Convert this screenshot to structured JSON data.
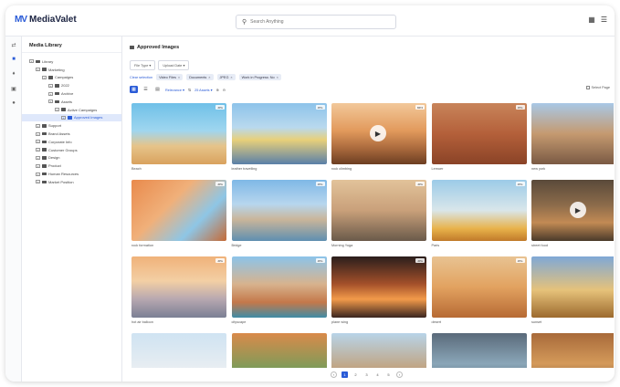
{
  "app": {
    "name": "MediaValet",
    "logo_mark": "MV"
  },
  "search": {
    "placeholder": "Search Anything"
  },
  "sidebar": {
    "title": "Media Library",
    "tree": [
      {
        "label": "Library",
        "depth": 0
      },
      {
        "label": "Marketing",
        "depth": 1
      },
      {
        "label": "Campaigns",
        "depth": 2
      },
      {
        "label": "2022",
        "depth": 3
      },
      {
        "label": "Archive",
        "depth": 3
      },
      {
        "label": "Assets",
        "depth": 3
      },
      {
        "label": "Active Campaigns",
        "depth": 4
      },
      {
        "label": "Approved Images",
        "depth": 5,
        "selected": true
      },
      {
        "label": "Support",
        "depth": 1
      },
      {
        "label": "Brand Assets",
        "depth": 1
      },
      {
        "label": "Corporate Info",
        "depth": 1
      },
      {
        "label": "Customer Groups",
        "depth": 1
      },
      {
        "label": "Design",
        "depth": 1
      },
      {
        "label": "Product",
        "depth": 1
      },
      {
        "label": "Human Resources",
        "depth": 1
      },
      {
        "label": "Market Position",
        "depth": 1
      }
    ]
  },
  "main": {
    "breadcrumb": "Approved Images",
    "filters": [
      {
        "label": "File Type"
      },
      {
        "label": "Upload Date"
      }
    ],
    "clear_label": "Clear selection",
    "chips": [
      {
        "label": "Video Files"
      },
      {
        "label": "Documents"
      },
      {
        "label": "JPEG"
      },
      {
        "label": "Work in Progress: No"
      }
    ],
    "sort_label": "Relevance",
    "per_page": "25 Assets",
    "select_page": "Select Page"
  },
  "colors": {
    "accent": "#2a5bd7"
  },
  "assets": [
    {
      "caption": "Beach",
      "badge": "JPG",
      "bg": "linear-gradient(#6fc0e8 0%,#9fd6ef 45%,#e6c48a 70%,#d9a25e 100%)"
    },
    {
      "caption": "leather travelling",
      "badge": "JPG",
      "bg": "linear-gradient(#8dc3ea 0%,#b9d9ee 40%,#e8d07a 60%,#5a7fa8 100%)"
    },
    {
      "caption": "rock climbing",
      "badge": "MP4",
      "bg": "linear-gradient(#f2c89a 0%,#e29a5c 45%,#a8683c 75%,#6c3e22 100%)",
      "video": true
    },
    {
      "caption": "Lemuer",
      "badge": "JPG",
      "bg": "linear-gradient(#c8845a 0%,#b4603a 50%,#8a4327 100%)"
    },
    {
      "caption": "new york",
      "badge": "JPG",
      "bg": "linear-gradient(#a8c8e6 0%,#c59a70 50%,#7a5a44 100%)"
    },
    {
      "caption": "rock formation",
      "badge": "JPG",
      "bg": "linear-gradient(135deg,#e98a4c 0%,#f0b07a 40%,#8ec6e6 70%,#c56a36 100%)"
    },
    {
      "caption": "Bridge",
      "badge": "JPG",
      "bg": "linear-gradient(#7fb8e6 0%,#b7d6ee 40%,#c9b59a 65%,#5f8fb0 100%)"
    },
    {
      "caption": "Morning Yoga",
      "badge": "JPG",
      "bg": "linear-gradient(#e2c39a 0%,#c9a07a 50%,#6a5a4a 100%)"
    },
    {
      "caption": "Paris",
      "badge": "JPG",
      "bg": "linear-gradient(#9ccbe8 0%,#d9e6ea 50%,#e8b24a 80%,#c07a2a 100%)"
    },
    {
      "caption": "street food",
      "badge": "MP4",
      "bg": "linear-gradient(#5a4a3a 0%,#8a6a4a 40%,#c28a54 70%,#4a3a2a 100%)",
      "video": true
    },
    {
      "caption": "hot air balloon",
      "badge": "JPG",
      "bg": "linear-gradient(#f0b27a 0%,#f3cfa4 40%,#b7a7b0 70%,#7a7f94 100%)"
    },
    {
      "caption": "cityscape",
      "badge": "JPG",
      "bg": "linear-gradient(#8cc4ea 0%,#d7b38e 45%,#c4784a 75%,#3f8ca6 100%)"
    },
    {
      "caption": "plane wing",
      "badge": "JPG",
      "bg": "linear-gradient(#2a1e1c 0%,#a4502a 45%,#f29a4a 70%,#3a2520 100%)"
    },
    {
      "caption": "desert",
      "badge": "JPG",
      "bg": "linear-gradient(#e8c392 0%,#e2a260 50%,#b76a34 100%)"
    },
    {
      "caption": "sunset",
      "badge": "JPG",
      "bg": "linear-gradient(#7fa8d6 0%,#e6c27a 55%,#9c6a2e 100%)"
    },
    {
      "caption": "",
      "badge": "",
      "bg": "linear-gradient(#cfe3f2 0%,#e9eef2 60%,#c8b8a4 100%)"
    },
    {
      "caption": "",
      "badge": "",
      "bg": "linear-gradient(#d98a4a 0%,#7a9c5a 60%,#4a6a3a 100%)"
    },
    {
      "caption": "",
      "badge": "",
      "bg": "linear-gradient(#b8d4e8 0%,#c0a686 55%,#6a5a4a 100%)"
    },
    {
      "caption": "",
      "badge": "",
      "bg": "linear-gradient(#5a6a7a 0%,#8aa6b8 50%,#3a4a5a 100%)"
    },
    {
      "caption": "",
      "badge": "",
      "bg": "linear-gradient(#a86a3a 0%,#d49a5a 50%,#5a3a2a 100%)"
    }
  ],
  "pagination": {
    "pages": [
      "1",
      "2",
      "3",
      "4",
      "5"
    ],
    "current": "1",
    "prev": "‹",
    "next": "›"
  }
}
